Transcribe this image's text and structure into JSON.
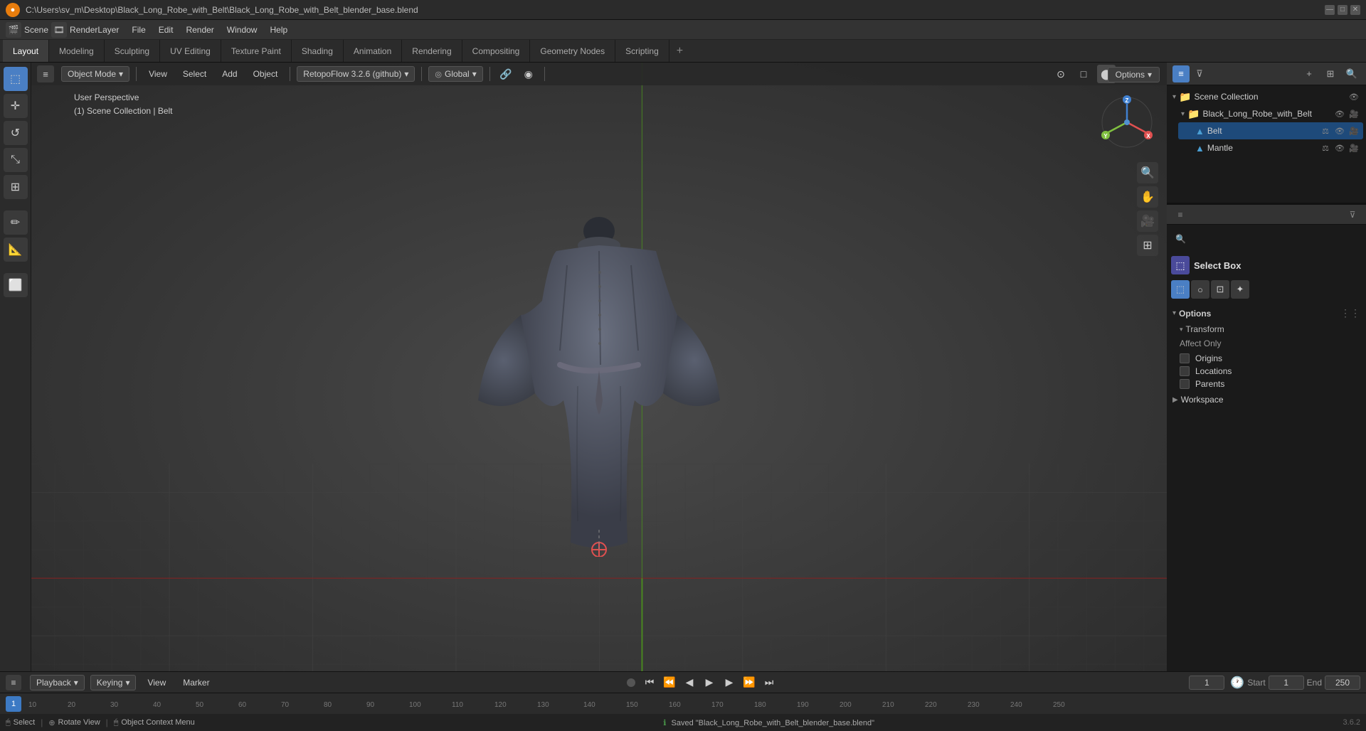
{
  "titlebar": {
    "app_name": "Blender",
    "title": "C:\\Users\\sv_m\\Desktop\\Black_Long_Robe_with_Belt\\Black_Long_Robe_with_Belt_blender_base.blend",
    "min_label": "—",
    "max_label": "□",
    "close_label": "✕"
  },
  "menubar": {
    "items": [
      "File",
      "Edit",
      "Render",
      "Window",
      "Help"
    ]
  },
  "workspace_tabs": {
    "items": [
      "Layout",
      "Modeling",
      "Sculpting",
      "UV Editing",
      "Texture Paint",
      "Shading",
      "Animation",
      "Rendering",
      "Compositing",
      "Geometry Nodes",
      "Scripting"
    ],
    "active": "Layout",
    "plus_label": "+"
  },
  "viewport": {
    "mode": "Object Mode",
    "view_label": "View",
    "select_label": "Select",
    "add_label": "Add",
    "object_label": "Object",
    "addon_label": "RetopoFlow 3.2.6 (github)",
    "transform_label": "Global",
    "info_line1": "User Perspective",
    "info_line2": "(1) Scene Collection | Belt",
    "options_label": "Options",
    "options_arrow": "▾"
  },
  "scene_panel": {
    "title": "Scene Collection",
    "search_placeholder": "🔍",
    "items": [
      {
        "name": "Black_Long_Robe_with_Belt",
        "icon": "📁",
        "children": [
          {
            "name": "Belt",
            "icon": "▲",
            "selected": true
          },
          {
            "name": "Mantle",
            "icon": "▲",
            "selected": false
          }
        ]
      }
    ]
  },
  "tool_panel": {
    "search_placeholder": "🔍",
    "tool_name": "Select Box",
    "tool_icon": "⬚",
    "icon_buttons": [
      "⬚",
      "○",
      "⊡",
      "✦"
    ],
    "sections": {
      "options": {
        "label": "Options",
        "transform": {
          "label": "Transform",
          "affect_only": {
            "label": "Affect Only",
            "origins": {
              "label": "Origins",
              "checked": false
            },
            "locations": {
              "label": "Locations",
              "checked": false
            },
            "parents": {
              "label": "Parents",
              "checked": false
            }
          }
        },
        "workspace": {
          "label": "Workspace"
        }
      }
    }
  },
  "timeline": {
    "playback_label": "Playback",
    "keying_label": "Keying",
    "view_label": "View",
    "marker_label": "Marker",
    "start_label": "Start",
    "start_frame": "1",
    "end_label": "End",
    "end_frame": "250",
    "current_frame": "1",
    "frame_numbers": [
      "1",
      "10",
      "20",
      "30",
      "40",
      "50",
      "60",
      "70",
      "80",
      "90",
      "100",
      "110",
      "120",
      "130",
      "140",
      "150",
      "160",
      "170",
      "180",
      "190",
      "200",
      "210",
      "220",
      "230",
      "240",
      "250"
    ]
  },
  "statusbar": {
    "select_label": "Select",
    "rotate_label": "Rotate View",
    "context_label": "Object Context Menu",
    "saved_message": "Saved \"Black_Long_Robe_with_Belt_blender_base.blend\"",
    "version": "3.6.2"
  },
  "nav_gizmo": {
    "x_label": "X",
    "y_label": "Y",
    "z_label": "Z",
    "x_color": "#e05050",
    "y_color": "#80c040",
    "z_color": "#4080d0",
    "dot_color": "#5090d0"
  }
}
